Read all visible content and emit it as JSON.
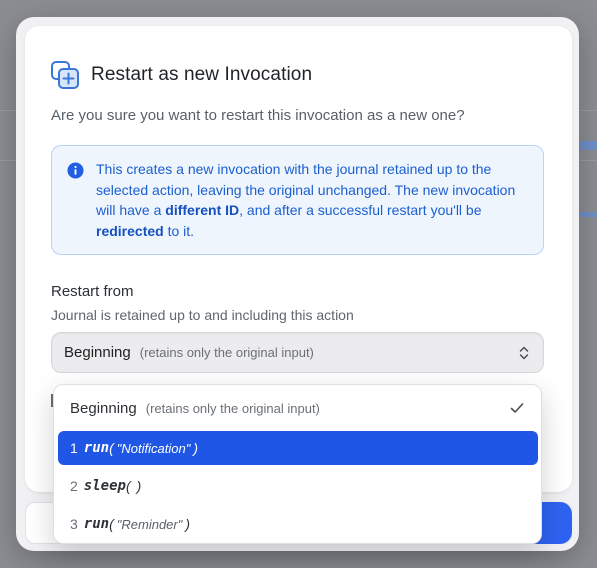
{
  "dialog": {
    "title": "Restart as new Invocation",
    "subtitle": "Are you sure you want to restart this invocation as a new one?",
    "info": {
      "part1": "This creates a new invocation with the journal retained up to the selected action, leaving the original unchanged. The new invocation will have a ",
      "bold1": "different ID",
      "part2": ", and after a successful restart you'll be ",
      "bold2": "redirected",
      "part3": " to it."
    },
    "restart_from": {
      "label": "Restart from",
      "hint": "Journal is retained up to and including this action",
      "selected_value": "Beginning",
      "selected_note": "(retains only the original input)"
    }
  },
  "dropdown": {
    "first_option": {
      "label": "Beginning",
      "note": "(retains only the original input)",
      "checked": true
    },
    "items": [
      {
        "num": "1",
        "fn": "run",
        "open": "(",
        "arg": "\"Notification\"",
        "close": ")",
        "active": true
      },
      {
        "num": "2",
        "fn": "sleep",
        "open": "(",
        "arg": "",
        "close": ")",
        "active": false
      },
      {
        "num": "3",
        "fn": "run",
        "open": "(",
        "arg": "\"Reminder\"",
        "close": ")",
        "active": false
      }
    ]
  },
  "icons": {
    "title_icon": "copy-plus-icon",
    "info_icon": "info-icon",
    "select_icon": "chevron-up-down-icon",
    "check_icon": "check-icon"
  },
  "colors": {
    "accent": "#1f56e6",
    "info_text": "#1c5fd0",
    "info_bg": "#eef5fd",
    "info_border": "#b9d4f3"
  }
}
